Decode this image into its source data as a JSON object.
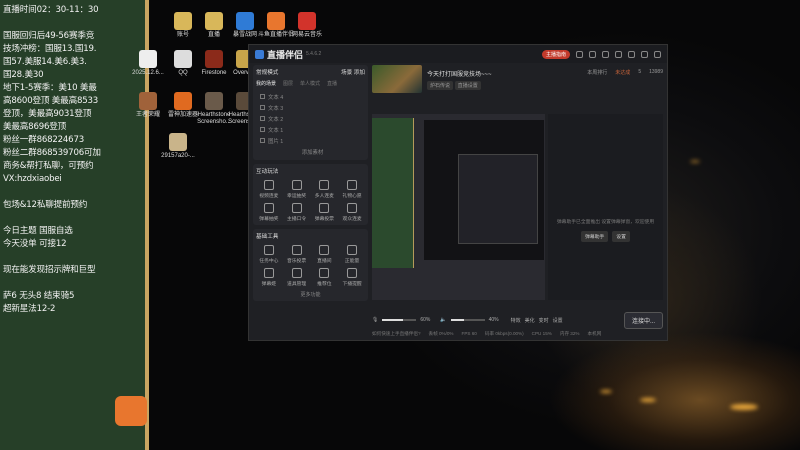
{
  "overlay": {
    "lines": [
      "直播时间02：30-11：30",
      "",
      "国服回归后49-56赛季竞",
      "技场冲榜：国服13.国19.",
      "国57.美服14.美6.美3.",
      "国28.美30",
      "地下1-5赛季：美10  美最",
      "高8600登顶  美最高8533",
      "登顶，美最高9031登顶",
      "美最高8696登顶",
      "粉丝一群868224673",
      "粉丝二群868539706可加",
      "商务&帮打私聊，可预约",
      "VX:hzdxiaobei",
      "",
      "包场&12私聊提前预约",
      "",
      "今日主题  国服自选",
      "今天没单  可接12",
      "",
      "现在能发现招示牌和巨型",
      "",
      "萨6 无头8 结束骑5",
      "超新星法12-2"
    ]
  },
  "desktop": {
    "icons": [
      {
        "label": "账号",
        "color": "#d8b75a"
      },
      {
        "label": "直播",
        "color": "#d8b75a"
      },
      {
        "label": "暴雪战网",
        "color": "#2f7bd6"
      },
      {
        "label": "斗鱼直播伴侣",
        "color": "#e8762e"
      },
      {
        "label": "网易云音乐",
        "color": "#d2332b"
      },
      {
        "label": "2025.12.6...",
        "color": "#eee"
      },
      {
        "label": "QQ",
        "color": "#ddd"
      },
      {
        "label": "Firestone",
        "color": "#8b2a1a"
      },
      {
        "label": "Overwolf",
        "color": "#c7a44a"
      },
      {
        "label": "王者荣耀",
        "color": "#a0623a"
      },
      {
        "label": "雷神加速器",
        "color": "#e06a20"
      },
      {
        "label": "Hearthstone Screensho...",
        "color": "#6a5a4a"
      },
      {
        "label": "Hearthstone Screensho...",
        "color": "#5a4a3a"
      },
      {
        "label": "29157a20-...",
        "color": "#c9b48a"
      }
    ]
  },
  "app": {
    "title": "直播伴侣",
    "version": "5.4.6.2",
    "anchor_btn": "主播指南",
    "open_live": "开播提醒",
    "share": "分享",
    "mode": {
      "label": "常规模式",
      "switch": "场景",
      "add": "添加"
    },
    "scenes": {
      "tabs": [
        "我的场景",
        "图层",
        "单人模式",
        "直播"
      ],
      "items": [
        "文本 4",
        "文本 3",
        "文本 2",
        "文本 1",
        "图片 1"
      ],
      "add": "添加素材"
    },
    "interact": {
      "title": "互动玩法",
      "items": [
        "视频连麦",
        "幸运抽奖",
        "多人连麦",
        "礼物心愿",
        "弹幕抽奖",
        "主播口令",
        "弹幕投票",
        "观众连麦"
      ]
    },
    "basic": {
      "title": "基础工具",
      "items": [
        "任务中心",
        "音乐投票",
        "直播间",
        "正能量",
        "弹幕姬",
        "道具管理",
        "推荐位",
        "下播提醒"
      ],
      "more": "更多功能"
    },
    "room": {
      "title": "今天打打国服竞技场~~~",
      "category": "炉石传说",
      "edit": "直播设置",
      "weekly": "本周排行",
      "rank": "未达成",
      "likes": "5",
      "fans": "13989"
    },
    "chat": {
      "hint": "弹幕助手已全面推出 设置弹幕弹窗，欢迎使用",
      "btn1": "弹幕助手",
      "btn2": "设置"
    },
    "controls": {
      "mic": "麦克风",
      "mic_vol": "60%",
      "speaker": "扬声器",
      "spk_vol": "40%",
      "t1": "特效",
      "t2": "美化",
      "t3": "变时",
      "t4": "设置",
      "live": "连接中..."
    },
    "status": {
      "hint": "如何快速上手直播伴侣?",
      "s1": "丢帧 0%/0%",
      "s2": "FPS 60",
      "s3": "码率 0kbps(0.00%)",
      "s4": "CPU 15%",
      "s5": "内存 32%",
      "s6": "本机网"
    }
  }
}
